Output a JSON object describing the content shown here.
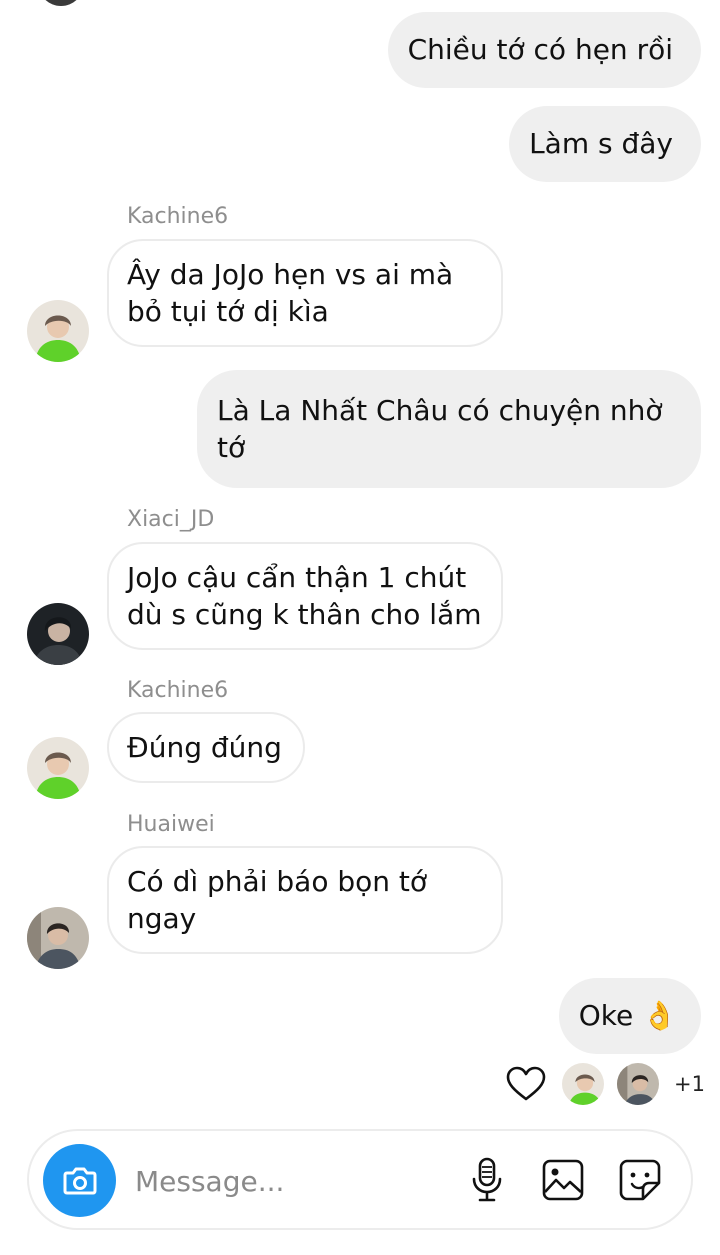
{
  "messages": {
    "out_1": "Chiều tớ có hẹn rồi",
    "out_2": "Làm s đây",
    "sender_1": "Kachine6",
    "in_1_line1": "Ây da JoJo hẹn vs ai mà",
    "in_1_line2": "bỏ tụi tớ dị kìa",
    "out_3_line1": "Là La Nhất Châu có chuyện nhờ",
    "out_3_line2": "tớ",
    "sender_2": "Xiaci_JD",
    "in_2_line1": "JoJo cậu cẩn thận 1 chút",
    "in_2_line2": "dù s cũng k thân cho lắm",
    "sender_3": "Kachine6",
    "in_3": "Đúng đúng",
    "sender_4": "Huaiwei",
    "in_4_line1": "Có dì phải báo bọn tớ",
    "in_4_line2": "ngay",
    "out_4": "Oke 👌"
  },
  "reactions": {
    "extra_count": "+1",
    "heart_icon": "heart-outline-icon"
  },
  "composer": {
    "placeholder": "Message...",
    "camera_icon": "camera-icon",
    "mic_icon": "microphone-icon",
    "gallery_icon": "image-gallery-icon",
    "sticker_icon": "sticker-icon",
    "camera_color": "#1f96f0"
  }
}
